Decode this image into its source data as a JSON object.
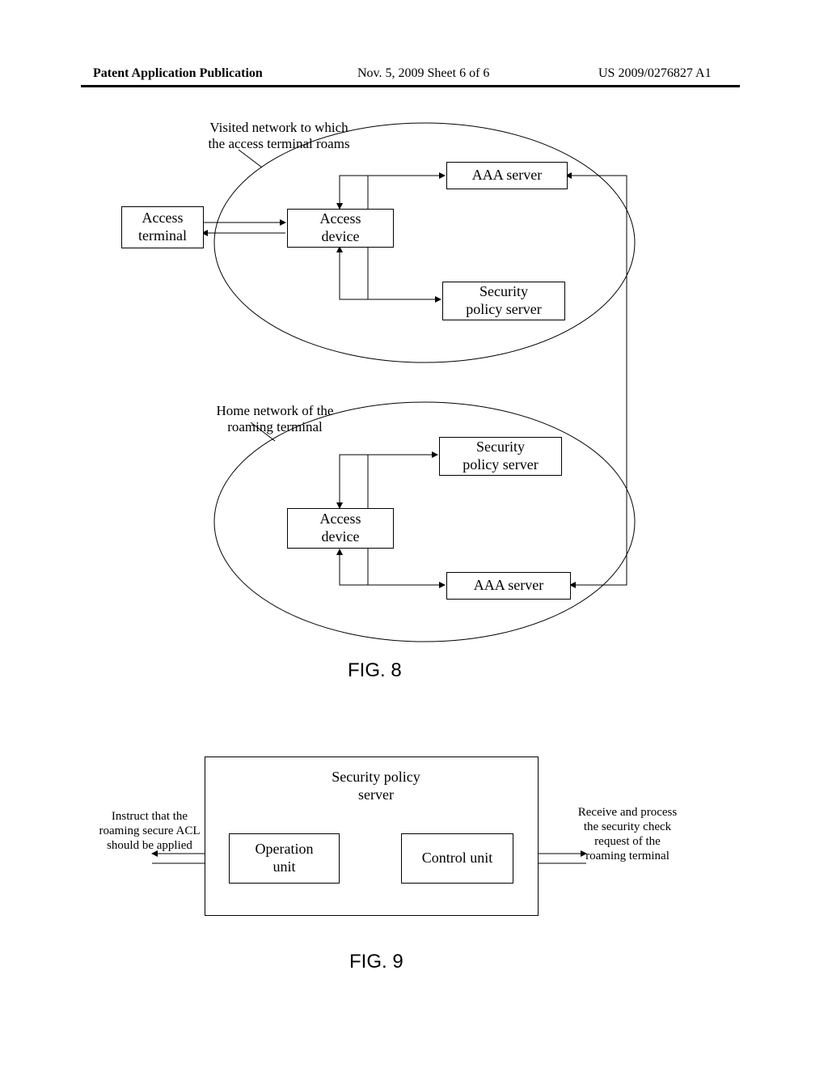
{
  "header": {
    "left": "Patent Application Publication",
    "mid": "Nov. 5, 2009   Sheet 6 of 6",
    "right": "US 2009/0276827 A1"
  },
  "fig8": {
    "visited_label": "Visited network to which\nthe access terminal roams",
    "home_label": "Home network of the\nroaming terminal",
    "access_terminal": "Access\nterminal",
    "access_device_top": "Access\ndevice",
    "aaa_server_top": "AAA server",
    "sps_top": "Security\npolicy server",
    "access_device_bot": "Access\ndevice",
    "aaa_server_bot": "AAA server",
    "sps_bot": "Security\npolicy server",
    "caption": "FIG. 8"
  },
  "fig9": {
    "title": "Security policy\nserver",
    "operation_unit": "Operation\nunit",
    "control_unit": "Control unit",
    "left_label": "Instruct that the\nroaming secure ACL\nshould be applied",
    "right_label": "Receive and process\nthe security check\nrequest of the\nroaming terminal",
    "caption": "FIG. 9"
  }
}
